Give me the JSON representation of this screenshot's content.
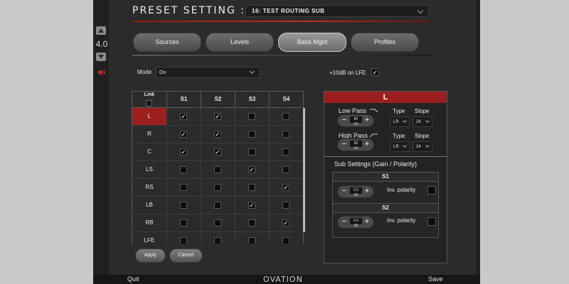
{
  "volume": {
    "value": "4.0"
  },
  "header": {
    "title": "PRESET SETTING :",
    "preset_value": "16: TEST ROUTING SUB"
  },
  "tabs": [
    {
      "label": "Sources",
      "active": false
    },
    {
      "label": "Levels",
      "active": false
    },
    {
      "label": "Bass Mgnt",
      "active": true
    },
    {
      "label": "Profiles",
      "active": false
    }
  ],
  "mode": {
    "label": "Mode",
    "value": "On"
  },
  "lfe": {
    "label": "+10dB on LFE",
    "checked": true,
    "mark": "✓"
  },
  "grid": {
    "link_label": "Link",
    "columns": [
      "S1",
      "S2",
      "S3",
      "S4"
    ],
    "rows": [
      {
        "name": "L",
        "selected": true,
        "checks": [
          true,
          true,
          false,
          false
        ]
      },
      {
        "name": "R",
        "selected": false,
        "checks": [
          true,
          true,
          false,
          false
        ]
      },
      {
        "name": "C",
        "selected": false,
        "checks": [
          true,
          true,
          false,
          false
        ]
      },
      {
        "name": "LS",
        "selected": false,
        "checks": [
          false,
          false,
          true,
          false
        ]
      },
      {
        "name": "RS",
        "selected": false,
        "checks": [
          false,
          false,
          false,
          true
        ]
      },
      {
        "name": "LB",
        "selected": false,
        "checks": [
          false,
          false,
          true,
          false
        ]
      },
      {
        "name": "RB",
        "selected": false,
        "checks": [
          false,
          false,
          false,
          true
        ]
      },
      {
        "name": "LFE",
        "selected": false,
        "checks": [
          false,
          false,
          false,
          false
        ]
      }
    ]
  },
  "buttons": {
    "apply": "Apply",
    "cancel": "Cancel"
  },
  "panel": {
    "channel": "L",
    "low_pass": {
      "label": "Low Pass",
      "value": "80",
      "unit": "Hz",
      "type_label": "Type",
      "type": "LR",
      "slope_label": "Slope",
      "slope": "24"
    },
    "high_pass": {
      "label": "High Pass",
      "value": "80",
      "unit": "Hz",
      "type_label": "Type",
      "type": "LR",
      "slope_label": "Slope",
      "slope": "24"
    },
    "sub_settings_label": "Sub Settings (Gain / Polarity)",
    "subs": [
      {
        "name": "S1",
        "gain": "0.0",
        "unit": "dB",
        "polarity_label": "Inv. polarity"
      },
      {
        "name": "S2",
        "gain": "0.0",
        "unit": "dB",
        "polarity_label": "Inv. polarity"
      }
    ]
  },
  "footer": {
    "quit": "Quit",
    "brand": "OVATION",
    "save": "Save"
  },
  "icons": {
    "mute": "mute-icon",
    "volume_up": "triangle-up-icon",
    "volume_down": "triangle-down-icon"
  },
  "colors": {
    "accent": "#9c1f1f",
    "background": "#2b2b2b"
  }
}
